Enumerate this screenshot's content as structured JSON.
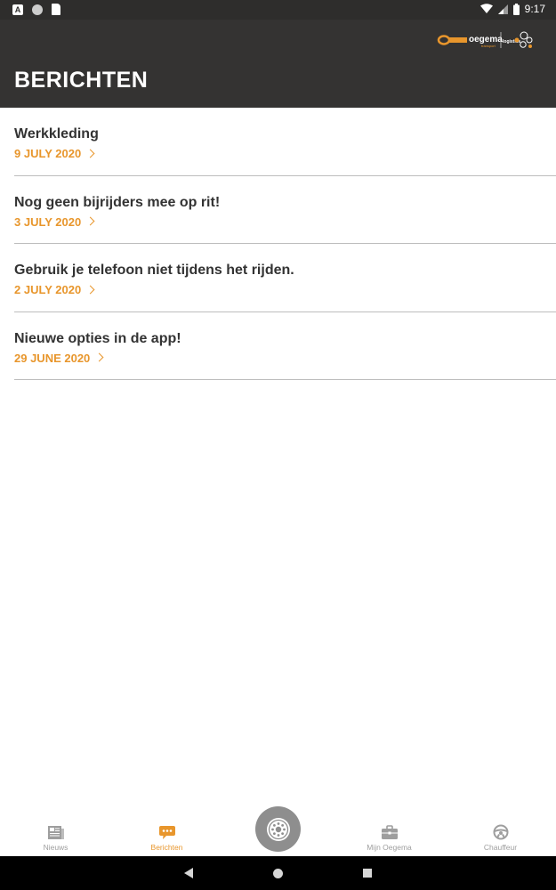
{
  "status_bar": {
    "time": "9:17"
  },
  "header": {
    "title": "BERICHTEN",
    "logo_name": "oegema",
    "logo_sub": "logistics"
  },
  "messages": [
    {
      "title": "Werkkleding",
      "date": "9 JULY 2020"
    },
    {
      "title": "Nog geen bijrijders mee op rit!",
      "date": "3 JULY 2020"
    },
    {
      "title": "Gebruik je telefoon niet tijdens het rijden.",
      "date": "2 JULY 2020"
    },
    {
      "title": "Nieuwe opties in de app!",
      "date": "29 JUNE 2020"
    }
  ],
  "tabs": [
    {
      "label": "Nieuws",
      "icon": "newspaper-icon",
      "active": false
    },
    {
      "label": "Berichten",
      "icon": "chat-icon",
      "active": true
    },
    {
      "label": "Mijn Oegema",
      "icon": "briefcase-icon",
      "active": false
    },
    {
      "label": "Chauffeur",
      "icon": "steering-wheel-icon",
      "active": false
    }
  ],
  "center_button": {
    "icon": "wheel-icon"
  },
  "colors": {
    "accent": "#e8962c",
    "header_bg": "#343332",
    "divider": "#bdbdbd",
    "tab_inactive": "#9e9e9e"
  }
}
